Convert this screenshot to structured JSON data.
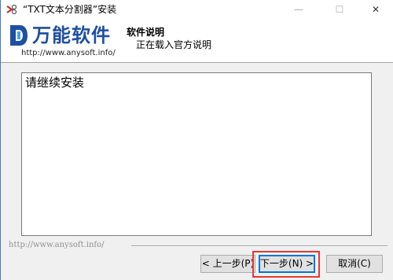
{
  "window": {
    "title": "“TXT文本分割器”安装",
    "controls": {
      "minimize": "—",
      "maximize": "☐",
      "close": "✕"
    }
  },
  "header": {
    "logo_text": "万能软件",
    "logo_url": "http://www.anysoft.info/",
    "section_title": "软件说明",
    "section_subtitle": "正在载入官方说明"
  },
  "content": {
    "text": "请继续安装"
  },
  "footer": {
    "brand_text": "http://www.anysoft.info/"
  },
  "buttons": {
    "back": "< 上一步(P)",
    "next": "下一步(N) >",
    "cancel": "取消(C)"
  },
  "colors": {
    "logo_blue": "#1d4fa3",
    "highlight_red": "#e53935",
    "focus_blue": "#0078d7"
  }
}
